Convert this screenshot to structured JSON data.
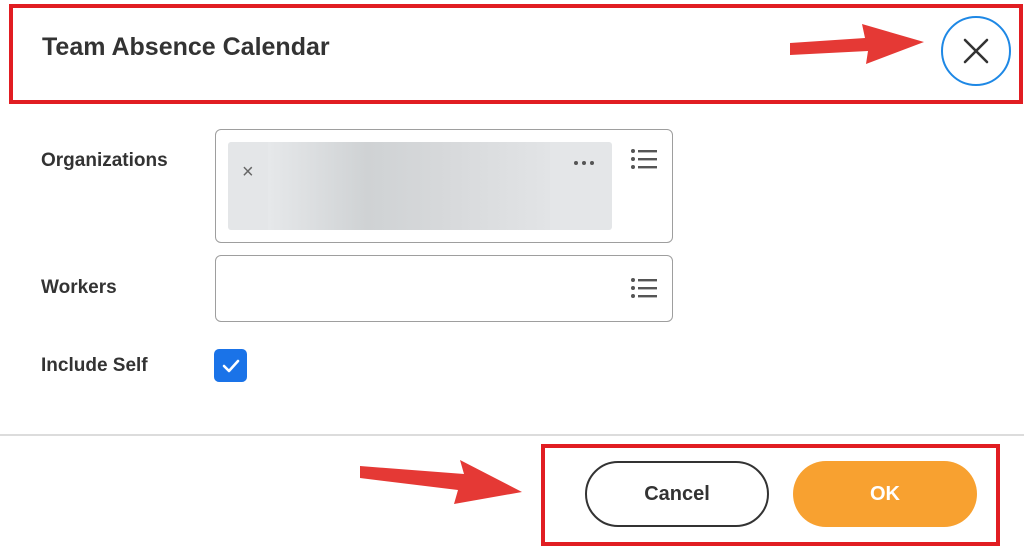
{
  "dialog": {
    "title": "Team Absence Calendar"
  },
  "fields": {
    "organizations_label": "Organizations",
    "workers_label": "Workers",
    "include_self_label": "Include Self",
    "include_self_checked": true
  },
  "footer": {
    "cancel_label": "Cancel",
    "ok_label": "OK"
  },
  "icons": {
    "close": "close-icon",
    "list": "list-icon",
    "remove": "remove-icon",
    "more": "more-icon",
    "check": "check-icon",
    "annotation_arrow": "arrow-icon"
  },
  "colors": {
    "highlight": "#e11d22",
    "close_ring": "#1e88e5",
    "checkbox": "#1a73e8",
    "ok_button": "#f8a130",
    "arrow": "#e53935"
  }
}
